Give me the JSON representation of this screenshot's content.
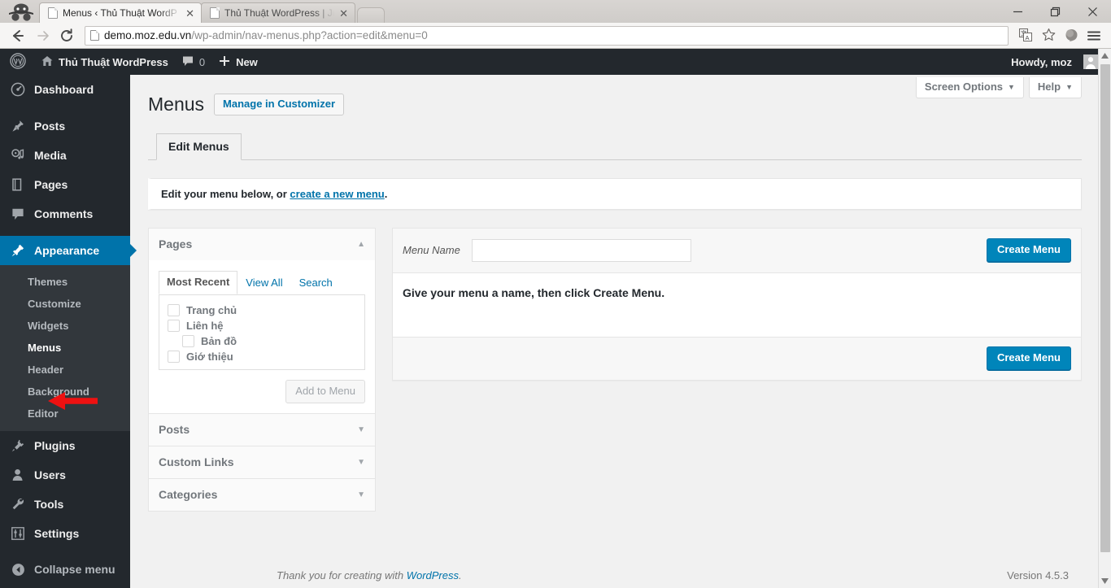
{
  "browser": {
    "tabs": [
      {
        "title": "Menus ‹ Thủ Thuật WordP",
        "close": "✕",
        "active": true
      },
      {
        "title": "Thủ Thuật WordPress | Jus",
        "close": "✕",
        "active": false
      }
    ],
    "window_controls": {
      "minimize": "—",
      "maximize": "❐",
      "close": "✕"
    },
    "nav": {
      "back": "←",
      "forward": "→",
      "reload": "⟳"
    },
    "url": {
      "host": "demo.moz.edu.vn",
      "path": "/wp-admin/nav-menus.php?action=edit&menu=0"
    },
    "toolbar_icons": [
      "translate-icon",
      "bookmark-star-icon",
      "profile-icon",
      "chrome-menu-icon"
    ]
  },
  "adminbar": {
    "logo": "wordpress-logo",
    "site_name": "Thủ Thuật WordPress",
    "comments_count": "0",
    "new_label": "New",
    "howdy": "Howdy, moz"
  },
  "sidebar": {
    "items": [
      {
        "label": "Dashboard",
        "icon": "dashboard-icon"
      },
      {
        "label": "Posts",
        "icon": "posts-pin-icon"
      },
      {
        "label": "Media",
        "icon": "media-icon"
      },
      {
        "label": "Pages",
        "icon": "pages-icon"
      },
      {
        "label": "Comments",
        "icon": "comments-icon"
      },
      {
        "label": "Appearance",
        "icon": "appearance-brush-icon",
        "current": true
      },
      {
        "label": "Plugins",
        "icon": "plugins-plug-icon"
      },
      {
        "label": "Users",
        "icon": "users-icon"
      },
      {
        "label": "Tools",
        "icon": "tools-wrench-icon"
      },
      {
        "label": "Settings",
        "icon": "settings-sliders-icon"
      }
    ],
    "submenu": [
      {
        "label": "Themes"
      },
      {
        "label": "Customize"
      },
      {
        "label": "Widgets"
      },
      {
        "label": "Menus",
        "current": true
      },
      {
        "label": "Header"
      },
      {
        "label": "Background"
      },
      {
        "label": "Editor"
      }
    ],
    "collapse": {
      "label": "Collapse menu",
      "icon": "collapse-arrow-icon"
    }
  },
  "screen_meta": {
    "screen_options": "Screen Options",
    "help": "Help",
    "caret": "▼"
  },
  "page": {
    "title": "Menus",
    "title_action": "Manage in Customizer",
    "tabs": [
      {
        "label": "Edit Menus",
        "active": true
      }
    ],
    "notice": {
      "prefix": "Edit your menu below, or ",
      "link": "create a new menu",
      "suffix": "."
    }
  },
  "accordion": {
    "panels": [
      {
        "title": "Pages",
        "toggle_icon": "chevron-up-icon",
        "toggle": "▲",
        "open": true,
        "tabs": [
          {
            "label": "Most Recent",
            "active": true
          },
          {
            "label": "View All",
            "active": false
          },
          {
            "label": "Search",
            "active": false
          }
        ],
        "items": [
          {
            "label": "Trang chủ",
            "child": false,
            "checked": false
          },
          {
            "label": "Liên hệ",
            "child": false,
            "checked": false
          },
          {
            "label": "Bản đồ",
            "child": true,
            "checked": false
          },
          {
            "label": "Giớ thiệu",
            "child": false,
            "checked": false
          }
        ],
        "add_button": "Add to Menu"
      },
      {
        "title": "Posts",
        "toggle_icon": "chevron-down-icon",
        "toggle": "▼",
        "open": false
      },
      {
        "title": "Custom Links",
        "toggle_icon": "chevron-down-icon",
        "toggle": "▼",
        "open": false
      },
      {
        "title": "Categories",
        "toggle_icon": "chevron-down-icon",
        "toggle": "▼",
        "open": false
      }
    ]
  },
  "menu_editor": {
    "name_label": "Menu Name",
    "name_value": "",
    "name_placeholder": "",
    "create_button_top": "Create Menu",
    "instruction": "Give your menu a name, then click Create Menu.",
    "create_button_bottom": "Create Menu"
  },
  "footer": {
    "thanks_prefix": "Thank you for creating with ",
    "thanks_link": "WordPress",
    "thanks_suffix": ".",
    "version": "Version 4.5.3"
  },
  "annotation": {
    "arrow": "red-left-arrow pointing at Menus"
  },
  "colors": {
    "wp_blue": "#0073aa",
    "button_blue": "#0085ba",
    "admin_dark": "#23282d",
    "submenu_dark": "#32373c",
    "annotation_red": "#ee1111"
  }
}
